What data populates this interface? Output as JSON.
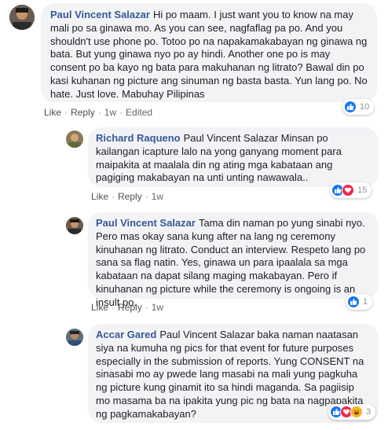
{
  "comments": [
    {
      "author": "Paul Vincent Salazar",
      "text": "Hi po maam. I just want you to know na may mali po sa ginawa mo. As you can see, nagfaflag pa po. And you shouldn't use phone po. Totoo po na napakamakabayan ng ginawa ng bata. But yung ginawa nyo po ay hindi. Another one po is may consent po ba kayo ng bata para makuhanan ng litrato? Bawal din po kasi kuhanan ng picture ang sinuman ng basta basta. Yun lang po. No hate. Just love. Mabuhay Pilipinas",
      "like": "Like",
      "reply": "Reply",
      "time": "1w",
      "edited": "Edited",
      "reaction_count": "10",
      "reactions": [
        "like"
      ]
    },
    {
      "author": "Richard Raqueno",
      "text": "Paul Vincent Salazar Minsan po kailangan icapture lalo na yong ganyang moment para maipakita at maalala din ng ating mga kabataan ang pagiging makabayan na unti unting nawawala..",
      "like": "Like",
      "reply": "Reply",
      "time": "1w",
      "reaction_count": "15",
      "reactions": [
        "like",
        "love"
      ]
    },
    {
      "author": "Paul Vincent Salazar",
      "text": "Tama din naman po yung sinabi nyo. Pero mas okay sana kung after na lang ng ceremony kinuhanan ng litrato. Conduct an interview. Respeto lang po sana sa flag natin. Yes, ginawa un para ipaalala sa mga kabataan na dapat silang maging makabayan. Pero if kinuhanan ng picture while the ceremony is ongoing is an insult po.",
      "like": "Like",
      "reply": "Reply",
      "time": "1w",
      "reaction_count": "1",
      "reactions": [
        "like"
      ]
    },
    {
      "author": "Accar Gared",
      "text": "Paul Vincent Salazar baka naman naatasan siya na kumuha ng pics for that event for future purposes especially in the submission of reports. Yung CONSENT na sinasabi mo ay pwede lang masabi na mali yung pagkuha ng picture kung ginamit ito sa hindi maganda. Sa pagiisip mo masama ba na ipakita yung pic ng bata na nagpapakita ng pagkamakabayan?",
      "reaction_count": "3",
      "reactions": [
        "like",
        "love",
        "haha"
      ]
    }
  ],
  "colors": {
    "author": "#385898",
    "bubble": "#f2f3f5",
    "like": "#1877f2",
    "love": "#f0284a",
    "haha": "#f7b125"
  }
}
